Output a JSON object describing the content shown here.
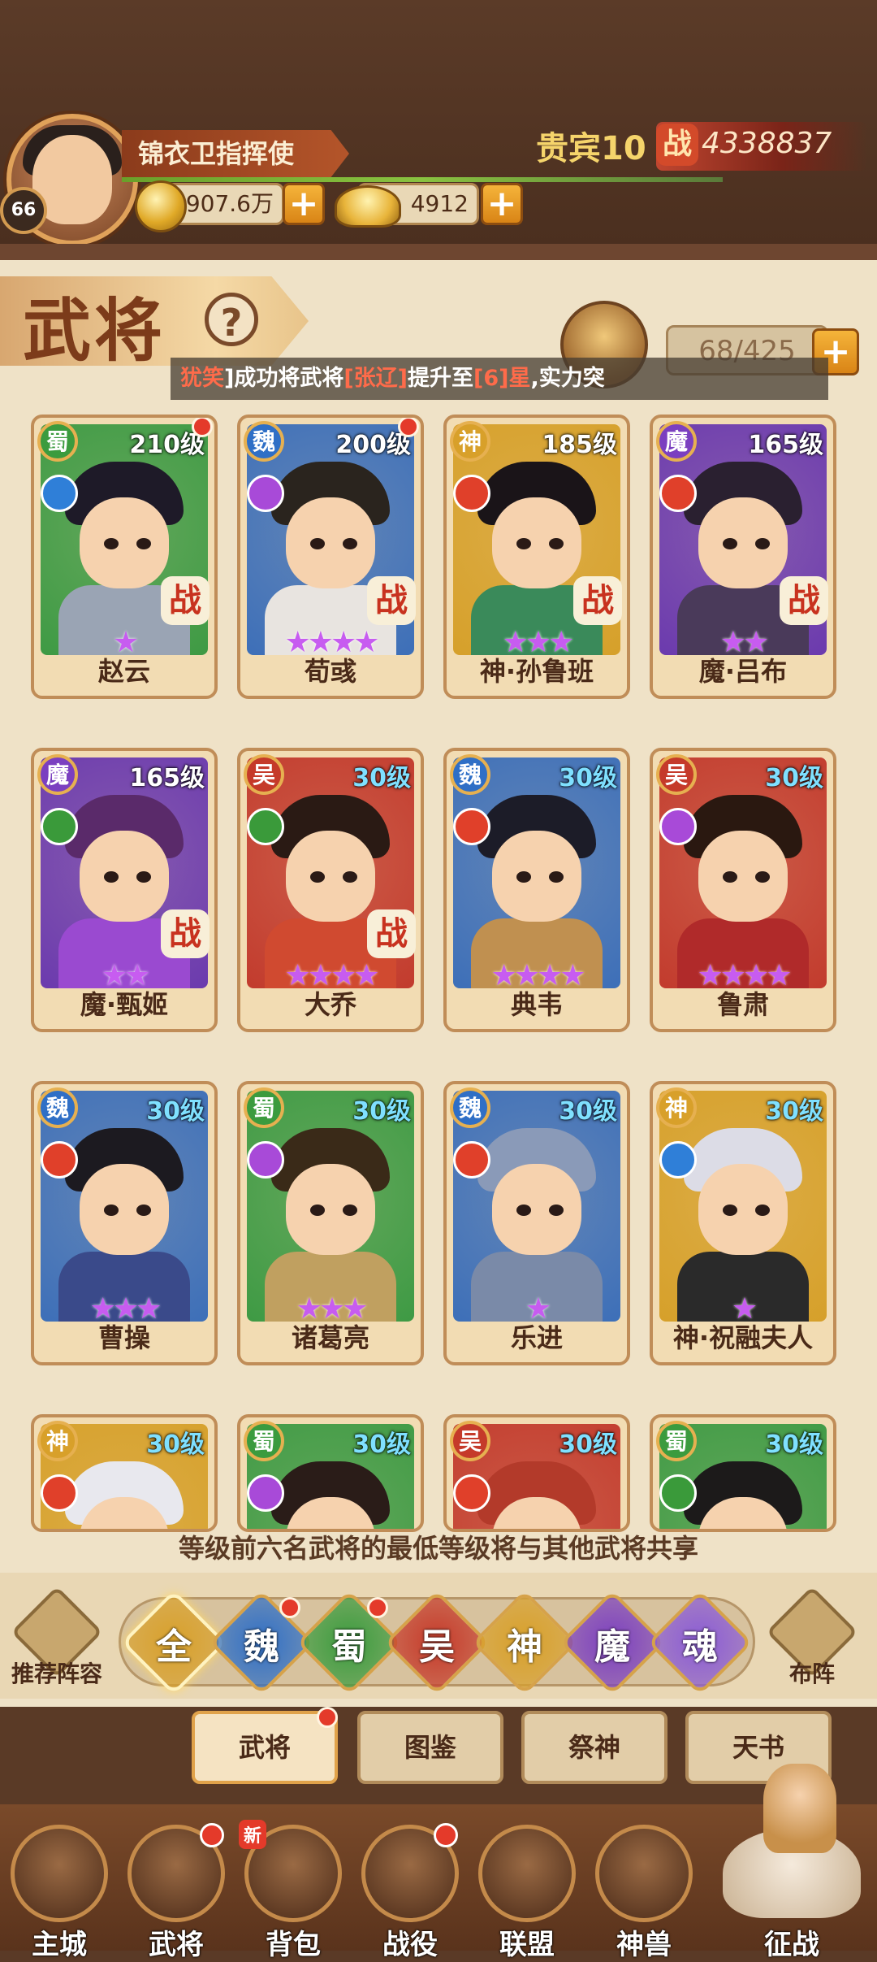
{
  "player": {
    "title": "锦衣卫指挥使",
    "level": "66",
    "vip": "贵宾10",
    "power_icon": "战",
    "power": "4338837"
  },
  "currency": {
    "copper": "1907.6万",
    "gold": "4912",
    "plus": "+"
  },
  "page": {
    "title": "武将",
    "help": "?",
    "capacity": "68/425",
    "plus": "+"
  },
  "ticker": {
    "parts": [
      "犹笑",
      "]成功将武将",
      "[张辽]",
      "提升至",
      "[6]星",
      ",实力突"
    ]
  },
  "heroes": [
    {
      "name": "赵云",
      "faction": "蜀",
      "level": "210级",
      "stars": "★",
      "zhan": "战",
      "red_dot": true
    },
    {
      "name": "荀彧",
      "faction": "魏",
      "level": "200级",
      "stars": "★★★★",
      "zhan": "战",
      "red_dot": true
    },
    {
      "name": "神·孙鲁班",
      "faction": "神",
      "level": "185级",
      "stars": "★★★",
      "zhan": "战",
      "red_dot": false
    },
    {
      "name": "魔·吕布",
      "faction": "魔",
      "level": "165级",
      "stars": "★★",
      "zhan": "战",
      "red_dot": false
    },
    {
      "name": "魔·甄姬",
      "faction": "魔",
      "level": "165级",
      "stars": "★★",
      "zhan": "战",
      "red_dot": false
    },
    {
      "name": "大乔",
      "faction": "吴",
      "level": "30级",
      "stars": "★★★★",
      "zhan": "战",
      "red_dot": false
    },
    {
      "name": "典韦",
      "faction": "魏",
      "level": "30级",
      "stars": "★★★★",
      "zhan": "",
      "red_dot": false
    },
    {
      "name": "鲁肃",
      "faction": "吴",
      "level": "30级",
      "stars": "★★★★",
      "zhan": "",
      "red_dot": false
    },
    {
      "name": "曹操",
      "faction": "魏",
      "level": "30级",
      "stars": "★★★",
      "zhan": "",
      "red_dot": false
    },
    {
      "name": "诸葛亮",
      "faction": "蜀",
      "level": "30级",
      "stars": "★★★",
      "zhan": "",
      "red_dot": false
    },
    {
      "name": "乐进",
      "faction": "魏",
      "level": "30级",
      "stars": "★",
      "zhan": "",
      "red_dot": false
    },
    {
      "name": "神·祝融夫人",
      "faction": "神",
      "level": "30级",
      "stars": "★",
      "zhan": "",
      "red_dot": false
    },
    {
      "name": "",
      "faction": "神",
      "level": "30级",
      "stars": "",
      "zhan": "",
      "red_dot": false
    },
    {
      "name": "",
      "faction": "蜀",
      "level": "30级",
      "stars": "",
      "zhan": "",
      "red_dot": false
    },
    {
      "name": "",
      "faction": "吴",
      "level": "30级",
      "stars": "",
      "zhan": "",
      "red_dot": false
    },
    {
      "name": "",
      "faction": "蜀",
      "level": "30级",
      "stars": "",
      "zhan": "",
      "red_dot": false
    }
  ],
  "notice": "等级前六名武将的最低等级将与其他武将共享",
  "filters": {
    "recommend": "推荐阵容",
    "formation": "布阵",
    "items": [
      "全",
      "魏",
      "蜀",
      "吴",
      "神",
      "魔",
      "魂"
    ]
  },
  "subtabs": [
    "武将",
    "图鉴",
    "祭神",
    "天书"
  ],
  "nav": [
    "主城",
    "武将",
    "背包",
    "战役",
    "联盟",
    "神兽",
    "征战"
  ],
  "nav_new": "新",
  "colors": {
    "wei": "#2f6fc6",
    "shu": "#3b9b3e",
    "wu": "#c53a2a",
    "shen": "#d8a02a",
    "mo": "#7b3fc0",
    "hun": "#8a5bd6",
    "accent": "#e43a2a"
  }
}
